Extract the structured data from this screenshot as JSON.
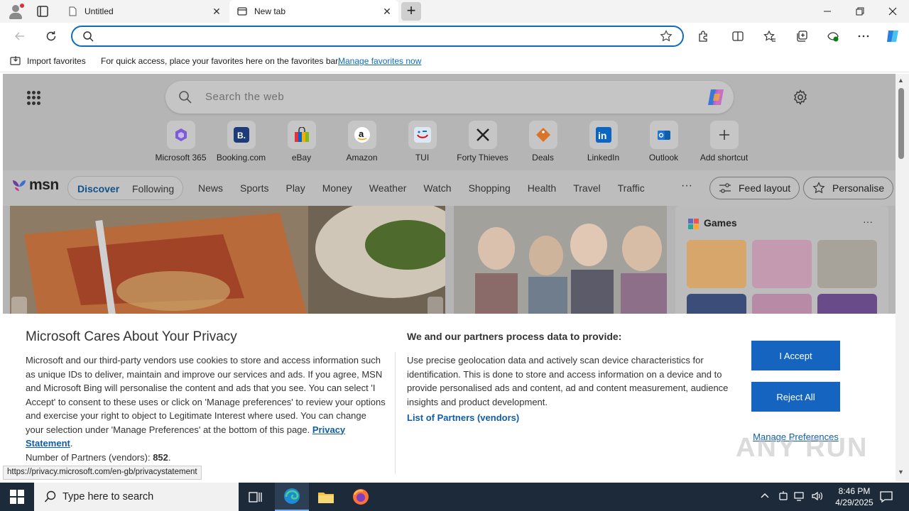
{
  "browser": {
    "tabs": [
      {
        "label": "Untitled",
        "active": false
      },
      {
        "label": "New tab",
        "active": true
      }
    ],
    "address_value": "",
    "favorites_bar": {
      "import_label": "Import favorites",
      "message": "For quick access, place your favorites here on the favorites bar.",
      "link": "Manage favorites now"
    }
  },
  "newtab": {
    "search_placeholder": "Search the web",
    "shortcuts": [
      {
        "label": "Microsoft 365",
        "icon": "microsoft-365-icon"
      },
      {
        "label": "Booking.com",
        "icon": "booking-icon"
      },
      {
        "label": "eBay",
        "icon": "ebay-icon"
      },
      {
        "label": "Amazon",
        "icon": "amazon-icon"
      },
      {
        "label": "TUI",
        "icon": "tui-icon"
      },
      {
        "label": "Forty Thieves",
        "icon": "forty-thieves-icon"
      },
      {
        "label": "Deals",
        "icon": "deals-icon"
      },
      {
        "label": "LinkedIn",
        "icon": "linkedin-icon"
      },
      {
        "label": "Outlook",
        "icon": "outlook-icon"
      },
      {
        "label": "Add shortcut",
        "icon": "plus-icon"
      }
    ],
    "msn": {
      "logo": "msn",
      "discover": "Discover",
      "following": "Following",
      "categories": [
        "News",
        "Sports",
        "Play",
        "Money",
        "Weather",
        "Watch",
        "Shopping",
        "Health",
        "Travel",
        "Traffic"
      ],
      "more": "···",
      "feed_layout": "Feed layout",
      "personalise": "Personalise"
    },
    "games": {
      "title": "Games",
      "more": "···"
    }
  },
  "privacy": {
    "title": "Microsoft Cares About Your Privacy",
    "body": "Microsoft and our third-party vendors use cookies to store and access information such as unique IDs to deliver, maintain and improve our services and ads. If you agree, MSN and Microsoft Bing will personalise the content and ads that you see. You can select 'I Accept' to consent to these uses or click on 'Manage preferences' to review your options and exercise your right to object to Legitimate Interest where used.  You can change your selection under 'Manage Preferences' at the bottom of this page.",
    "privacy_link": "Privacy Statement",
    "partners_label": "Number of Partners (vendors):",
    "partners_count": "852",
    "right_title": "We and our partners process data to provide:",
    "right_body": "Use precise geolocation data and actively scan device characteristics for identification. This is done to store and access information on a device and to provide personalised ads and content, ad and content measurement, audience insights and product development.",
    "partners_link": "List of Partners (vendors)",
    "accept": "I Accept",
    "reject": "Reject All",
    "manage": "Manage Preferences"
  },
  "status_url": "https://privacy.microsoft.com/en-gb/privacystatement",
  "watermark": "ANY RUN",
  "taskbar": {
    "search_placeholder": "Type here to search",
    "time": "8:46 PM",
    "date": "4/29/2025"
  },
  "colors": {
    "accent": "#0f6cbd",
    "button_blue": "#1565c0",
    "taskbar": "#1c2a3a"
  }
}
